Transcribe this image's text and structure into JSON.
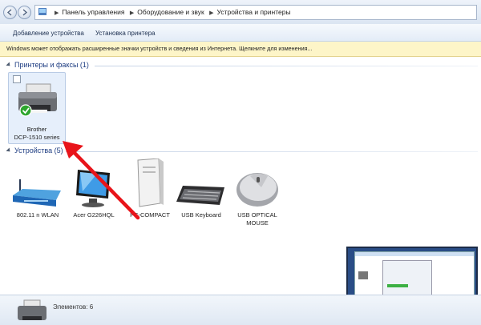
{
  "breadcrumbs": [
    "Панель управления",
    "Оборудование и звук",
    "Устройства и принтеры"
  ],
  "toolbar": {
    "add_device": "Добавление устройства",
    "add_printer": "Установка принтера"
  },
  "infobar": {
    "text": "Windows может отображать расширенные значки устройств и сведения из Интернета.  Щелкните для изменения..."
  },
  "printers_group": {
    "title": "Принтеры и факсы (1)",
    "items": [
      {
        "line1": "Brother",
        "line2": "DCP-1510 series",
        "icon": "printer-icon",
        "status": "default-printer"
      }
    ]
  },
  "devices_group": {
    "title": "Устройства (5)",
    "items": [
      {
        "label": "802.11 n WLAN",
        "icon": "router-icon"
      },
      {
        "label": "Acer G226HQL",
        "icon": "monitor-icon"
      },
      {
        "label": "PC-COMPACT",
        "icon": "computer-icon"
      },
      {
        "label": "USB Keyboard",
        "icon": "keyboard-icon"
      },
      {
        "label_line1": "USB OPTICAL",
        "label_line2": "MOUSE",
        "icon": "mouse-icon"
      }
    ]
  },
  "status": {
    "text": "Элементов: 6"
  },
  "colors": {
    "annotation_arrow": "#e8141a",
    "selection": "#e6effb",
    "link": "#1e3d82"
  }
}
